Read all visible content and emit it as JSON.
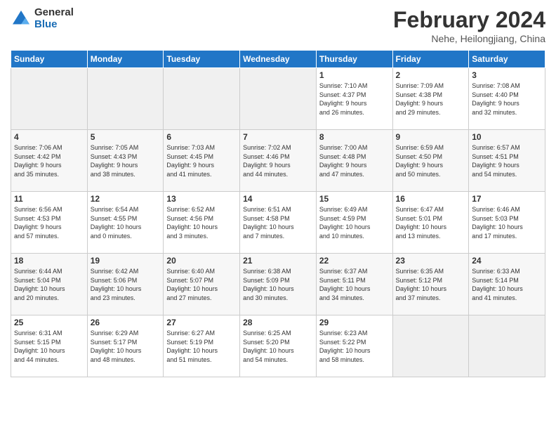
{
  "logo": {
    "general": "General",
    "blue": "Blue"
  },
  "header": {
    "month": "February 2024",
    "location": "Nehe, Heilongjiang, China"
  },
  "weekdays": [
    "Sunday",
    "Monday",
    "Tuesday",
    "Wednesday",
    "Thursday",
    "Friday",
    "Saturday"
  ],
  "weeks": [
    [
      {
        "day": "",
        "info": ""
      },
      {
        "day": "",
        "info": ""
      },
      {
        "day": "",
        "info": ""
      },
      {
        "day": "",
        "info": ""
      },
      {
        "day": "1",
        "info": "Sunrise: 7:10 AM\nSunset: 4:37 PM\nDaylight: 9 hours\nand 26 minutes."
      },
      {
        "day": "2",
        "info": "Sunrise: 7:09 AM\nSunset: 4:38 PM\nDaylight: 9 hours\nand 29 minutes."
      },
      {
        "day": "3",
        "info": "Sunrise: 7:08 AM\nSunset: 4:40 PM\nDaylight: 9 hours\nand 32 minutes."
      }
    ],
    [
      {
        "day": "4",
        "info": "Sunrise: 7:06 AM\nSunset: 4:42 PM\nDaylight: 9 hours\nand 35 minutes."
      },
      {
        "day": "5",
        "info": "Sunrise: 7:05 AM\nSunset: 4:43 PM\nDaylight: 9 hours\nand 38 minutes."
      },
      {
        "day": "6",
        "info": "Sunrise: 7:03 AM\nSunset: 4:45 PM\nDaylight: 9 hours\nand 41 minutes."
      },
      {
        "day": "7",
        "info": "Sunrise: 7:02 AM\nSunset: 4:46 PM\nDaylight: 9 hours\nand 44 minutes."
      },
      {
        "day": "8",
        "info": "Sunrise: 7:00 AM\nSunset: 4:48 PM\nDaylight: 9 hours\nand 47 minutes."
      },
      {
        "day": "9",
        "info": "Sunrise: 6:59 AM\nSunset: 4:50 PM\nDaylight: 9 hours\nand 50 minutes."
      },
      {
        "day": "10",
        "info": "Sunrise: 6:57 AM\nSunset: 4:51 PM\nDaylight: 9 hours\nand 54 minutes."
      }
    ],
    [
      {
        "day": "11",
        "info": "Sunrise: 6:56 AM\nSunset: 4:53 PM\nDaylight: 9 hours\nand 57 minutes."
      },
      {
        "day": "12",
        "info": "Sunrise: 6:54 AM\nSunset: 4:55 PM\nDaylight: 10 hours\nand 0 minutes."
      },
      {
        "day": "13",
        "info": "Sunrise: 6:52 AM\nSunset: 4:56 PM\nDaylight: 10 hours\nand 3 minutes."
      },
      {
        "day": "14",
        "info": "Sunrise: 6:51 AM\nSunset: 4:58 PM\nDaylight: 10 hours\nand 7 minutes."
      },
      {
        "day": "15",
        "info": "Sunrise: 6:49 AM\nSunset: 4:59 PM\nDaylight: 10 hours\nand 10 minutes."
      },
      {
        "day": "16",
        "info": "Sunrise: 6:47 AM\nSunset: 5:01 PM\nDaylight: 10 hours\nand 13 minutes."
      },
      {
        "day": "17",
        "info": "Sunrise: 6:46 AM\nSunset: 5:03 PM\nDaylight: 10 hours\nand 17 minutes."
      }
    ],
    [
      {
        "day": "18",
        "info": "Sunrise: 6:44 AM\nSunset: 5:04 PM\nDaylight: 10 hours\nand 20 minutes."
      },
      {
        "day": "19",
        "info": "Sunrise: 6:42 AM\nSunset: 5:06 PM\nDaylight: 10 hours\nand 23 minutes."
      },
      {
        "day": "20",
        "info": "Sunrise: 6:40 AM\nSunset: 5:07 PM\nDaylight: 10 hours\nand 27 minutes."
      },
      {
        "day": "21",
        "info": "Sunrise: 6:38 AM\nSunset: 5:09 PM\nDaylight: 10 hours\nand 30 minutes."
      },
      {
        "day": "22",
        "info": "Sunrise: 6:37 AM\nSunset: 5:11 PM\nDaylight: 10 hours\nand 34 minutes."
      },
      {
        "day": "23",
        "info": "Sunrise: 6:35 AM\nSunset: 5:12 PM\nDaylight: 10 hours\nand 37 minutes."
      },
      {
        "day": "24",
        "info": "Sunrise: 6:33 AM\nSunset: 5:14 PM\nDaylight: 10 hours\nand 41 minutes."
      }
    ],
    [
      {
        "day": "25",
        "info": "Sunrise: 6:31 AM\nSunset: 5:15 PM\nDaylight: 10 hours\nand 44 minutes."
      },
      {
        "day": "26",
        "info": "Sunrise: 6:29 AM\nSunset: 5:17 PM\nDaylight: 10 hours\nand 48 minutes."
      },
      {
        "day": "27",
        "info": "Sunrise: 6:27 AM\nSunset: 5:19 PM\nDaylight: 10 hours\nand 51 minutes."
      },
      {
        "day": "28",
        "info": "Sunrise: 6:25 AM\nSunset: 5:20 PM\nDaylight: 10 hours\nand 54 minutes."
      },
      {
        "day": "29",
        "info": "Sunrise: 6:23 AM\nSunset: 5:22 PM\nDaylight: 10 hours\nand 58 minutes."
      },
      {
        "day": "",
        "info": ""
      },
      {
        "day": "",
        "info": ""
      }
    ]
  ]
}
